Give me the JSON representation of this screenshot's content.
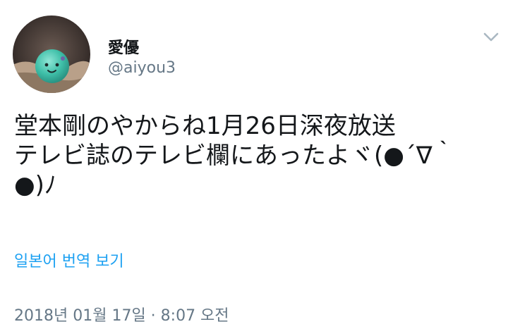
{
  "user": {
    "display_name": "愛優",
    "handle": "@aiyou3"
  },
  "tweet": {
    "text": "堂本剛のやからね1月26日深夜放送\nテレビ誌のテレビ欄にあったよヾ(●´∇｀●)ﾉ",
    "translate_label": "일본어 번역 보기",
    "timestamp": "2018년 01월 17일 · 8:07 오전"
  },
  "icons": {
    "caret": "chevron-down-icon",
    "avatar": "green-ball-avatar"
  },
  "colors": {
    "text": "#14171a",
    "secondary": "#657786",
    "link": "#1da1f2",
    "avatar_ball": "#4fc3b0"
  }
}
